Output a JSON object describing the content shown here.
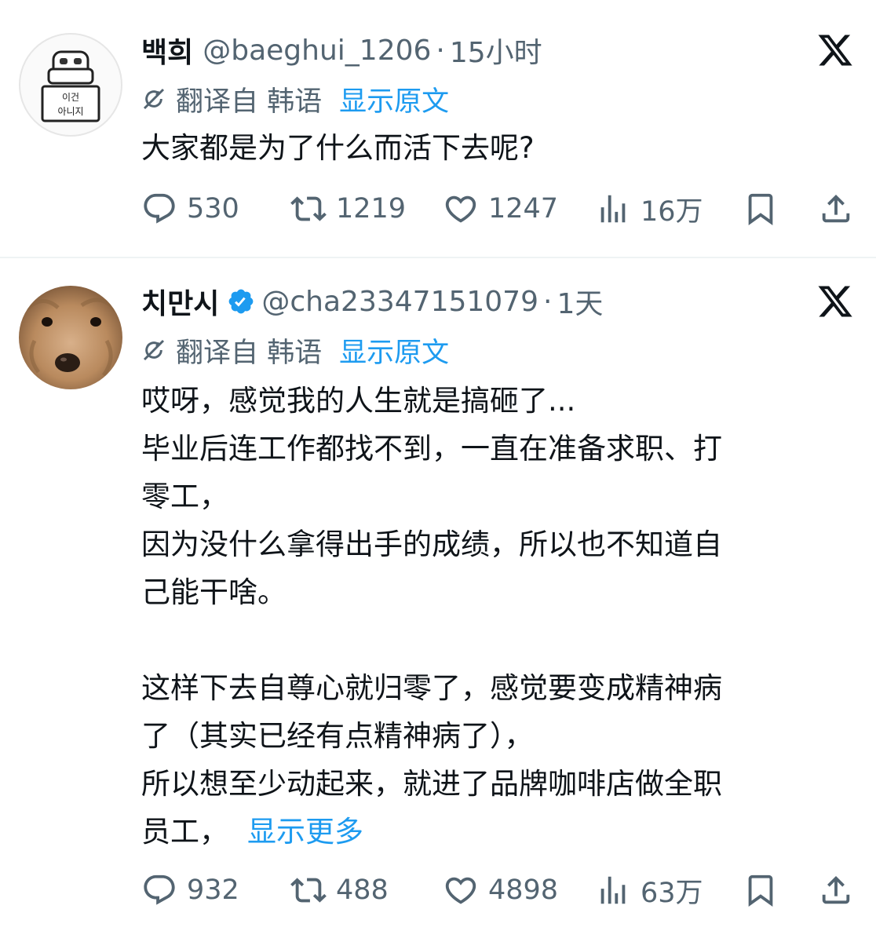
{
  "posts": [
    {
      "display_name": "백희",
      "handle": "@baeghui_1206",
      "sep": "·",
      "time": "15小时",
      "translated_from": "翻译自 韩语",
      "show_original": "显示原文",
      "lines": [
        "大家都是为了什么而活下去呢?"
      ],
      "show_more": "",
      "replies": "530",
      "reposts": "1219",
      "likes": "1247",
      "views": "16万",
      "avatar_text_1": "이건",
      "avatar_text_2": "아니지"
    },
    {
      "display_name": "치만시",
      "handle": "@cha23347151079",
      "sep": "·",
      "time": "1天",
      "translated_from": "翻译自 韩语",
      "show_original": "显示原文",
      "lines": [
        "哎呀，感觉我的人生就是搞砸了...",
        "毕业后连工作都找不到，一直在准备求职、打",
        "零工，",
        "因为没什么拿得出手的成绩，所以也不知道自",
        "己能干啥。",
        "",
        "这样下去自尊心就归零了，感觉要变成精神病",
        "了（其实已经有点精神病了），",
        "所以想至少动起来，就进了品牌咖啡店做全职",
        "员工，"
      ],
      "show_more": "显示更多",
      "replies": "932",
      "reposts": "488",
      "likes": "4898",
      "views": "63万"
    }
  ],
  "colors": {
    "text": "#0f1419",
    "secondary": "#536471",
    "link": "#1d9bf0",
    "verified": "#1d9bf0",
    "divider": "#eff3f4"
  },
  "icons": [
    "x-logo-icon",
    "translate-icon",
    "reply-icon",
    "repost-icon",
    "like-icon",
    "views-icon",
    "bookmark-icon",
    "share-icon",
    "verified-badge-icon"
  ]
}
